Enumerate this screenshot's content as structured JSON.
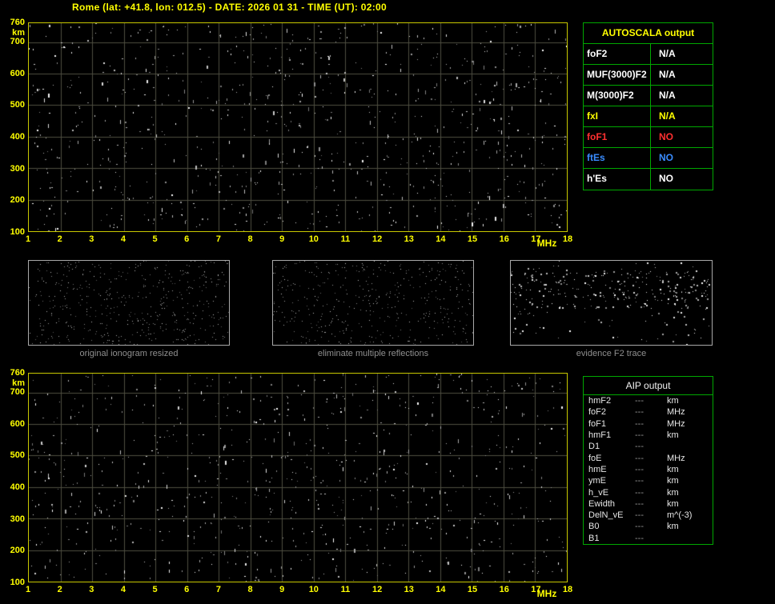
{
  "title": "Rome (lat: +41.8, lon: 012.5) - DATE: 2026 01 31 - TIME (UT): 02:00",
  "colors": {
    "background": "#000000",
    "title_text": "#ffff00",
    "plot_border": "#c8c800",
    "grid_line": "#4e4e40",
    "axis_label": "#ffff00",
    "table_border": "#00a800",
    "autoscala_header": "#ffff00",
    "white_text": "#ffffff",
    "red_text": "#ff3030",
    "blue_text": "#3a8cff",
    "caption_text": "#8f8f8f"
  },
  "ionogram": {
    "x_unit": "MHz",
    "y_unit": "km",
    "x_min": 1,
    "x_max": 18,
    "y_min": 100,
    "y_max": 760,
    "x_ticks": [
      1,
      2,
      3,
      4,
      5,
      6,
      7,
      8,
      9,
      10,
      11,
      12,
      13,
      14,
      15,
      16,
      17,
      18
    ],
    "y_ticks": [
      760,
      700,
      600,
      500,
      400,
      300,
      200,
      100
    ]
  },
  "chart_data": [
    {
      "type": "scatter",
      "title": "main ionogram (virtual height vs frequency)",
      "xlabel": "MHz",
      "ylabel": "km",
      "xlim": [
        1,
        18
      ],
      "ylim": [
        100,
        760
      ],
      "x_ticks": [
        1,
        2,
        3,
        4,
        5,
        6,
        7,
        8,
        9,
        10,
        11,
        12,
        13,
        14,
        15,
        16,
        17,
        18
      ],
      "y_ticks": [
        100,
        200,
        300,
        400,
        500,
        600,
        700,
        760
      ],
      "grid": true,
      "legend": "none",
      "series": [],
      "note": "no echo trace present; only random background speckle noise"
    },
    {
      "type": "scatter",
      "title": "AIP ionogram (virtual height vs frequency)",
      "xlabel": "MHz",
      "ylabel": "km",
      "xlim": [
        1,
        18
      ],
      "ylim": [
        100,
        760
      ],
      "x_ticks": [
        1,
        2,
        3,
        4,
        5,
        6,
        7,
        8,
        9,
        10,
        11,
        12,
        13,
        14,
        15,
        16,
        17,
        18
      ],
      "y_ticks": [
        100,
        200,
        300,
        400,
        500,
        600,
        700,
        760
      ],
      "grid": true,
      "legend": "none",
      "series": [],
      "note": "no echo trace present; only random background speckle noise"
    }
  ],
  "autoscala": {
    "header": "AUTOSCALA output",
    "rows": [
      {
        "label": "foF2",
        "value": "N/A",
        "label_color": "#ffffff",
        "value_color": "#ffffff"
      },
      {
        "label": "MUF(3000)F2",
        "value": "N/A",
        "label_color": "#ffffff",
        "value_color": "#ffffff"
      },
      {
        "label": "M(3000)F2",
        "value": "N/A",
        "label_color": "#ffffff",
        "value_color": "#ffffff"
      },
      {
        "label": "fxI",
        "value": "N/A",
        "label_color": "#ffff00",
        "value_color": "#ffff00"
      },
      {
        "label": "foF1",
        "value": "NO",
        "label_color": "#ff3030",
        "value_color": "#ff3030"
      },
      {
        "label": "ftEs",
        "value": "NO",
        "label_color": "#3a8cff",
        "value_color": "#3a8cff"
      },
      {
        "label": "h'Es",
        "value": "NO",
        "label_color": "#ffffff",
        "value_color": "#ffffff"
      }
    ]
  },
  "thumbnails": [
    {
      "caption": "original ionogram resized"
    },
    {
      "caption": "eliminate multiple reflections"
    },
    {
      "caption": "evidence F2 trace"
    }
  ],
  "aip": {
    "header": "AIP output",
    "rows": [
      {
        "label": "hmF2",
        "value": "---",
        "unit": "km"
      },
      {
        "label": "foF2",
        "value": "---",
        "unit": "MHz"
      },
      {
        "label": "foF1",
        "value": "---",
        "unit": "MHz"
      },
      {
        "label": "hmF1",
        "value": "---",
        "unit": "km"
      },
      {
        "label": "D1",
        "value": "---",
        "unit": ""
      },
      {
        "label": "foE",
        "value": "---",
        "unit": "MHz"
      },
      {
        "label": "hmE",
        "value": "---",
        "unit": "km"
      },
      {
        "label": "ymE",
        "value": "---",
        "unit": "km"
      },
      {
        "label": "h_vE",
        "value": "---",
        "unit": "km"
      },
      {
        "label": "Ewidth",
        "value": "---",
        "unit": "km"
      },
      {
        "label": "DelN_vE",
        "value": "---",
        "unit": "m^(-3)"
      },
      {
        "label": "B0",
        "value": "---",
        "unit": "km"
      },
      {
        "label": "B1",
        "value": "---",
        "unit": ""
      }
    ]
  }
}
